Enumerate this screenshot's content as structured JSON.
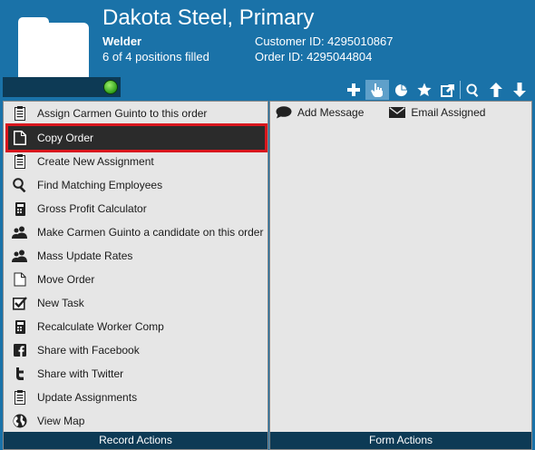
{
  "header": {
    "title": "Dakota Steel, Primary",
    "subtitle": "Welder",
    "positions": "6 of 4 positions filled",
    "customer_id": "Customer ID: 4295010867",
    "order_id": "Order ID: 4295044804"
  },
  "toolbar": {
    "icons": [
      "add-icon",
      "hand-pointer-icon",
      "pie-chart-icon",
      "star-icon",
      "external-link-icon",
      "search-icon",
      "arrow-up-icon",
      "arrow-down-icon"
    ],
    "active": "hand-pointer-icon"
  },
  "record_actions": {
    "items": [
      {
        "label": "Assign Carmen Guinto to this order",
        "icon": "document-list-icon"
      },
      {
        "label": "Copy Order",
        "icon": "copy-document-icon",
        "selected": true
      },
      {
        "label": "Create New Assignment",
        "icon": "document-list-icon"
      },
      {
        "label": "Find Matching Employees",
        "icon": "magnifier-icon"
      },
      {
        "label": "Gross Profit Calculator",
        "icon": "calculator-icon"
      },
      {
        "label": "Make Carmen Guinto a candidate on this order",
        "icon": "users-icon"
      },
      {
        "label": "Mass Update Rates",
        "icon": "users-icon"
      },
      {
        "label": "Move Order",
        "icon": "copy-document-icon"
      },
      {
        "label": "New Task",
        "icon": "checkbox-icon"
      },
      {
        "label": "Recalculate Worker Comp",
        "icon": "calculator-icon"
      },
      {
        "label": "Share with Facebook",
        "icon": "facebook-icon"
      },
      {
        "label": "Share with Twitter",
        "icon": "twitter-icon"
      },
      {
        "label": "Update Assignments",
        "icon": "document-list-icon"
      },
      {
        "label": "View Map",
        "icon": "globe-icon"
      }
    ],
    "footer": "Record Actions"
  },
  "form_actions": {
    "items": [
      {
        "label": "Add Message",
        "icon": "speech-bubble-icon"
      },
      {
        "label": "Email Assigned",
        "icon": "envelope-icon"
      }
    ],
    "footer": "Form Actions"
  },
  "colors": {
    "header_bg": "#1a72a8",
    "footer_bg": "#0d3a55",
    "highlight": "#d9171e",
    "selected_bg": "#2b2b2b"
  }
}
